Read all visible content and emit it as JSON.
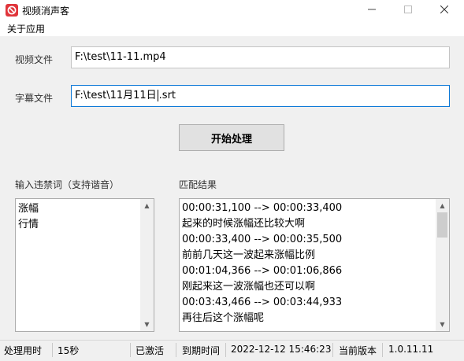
{
  "window": {
    "title": "视频消声客",
    "icon": "stop-sign-icon",
    "controls": {
      "minimize": "minimize-icon",
      "maximize": "maximize-icon",
      "close": "close-icon"
    }
  },
  "menu": {
    "items": [
      "关于应用"
    ]
  },
  "form": {
    "video_label": "视频文件",
    "video_value": "F:\\test\\11-11.mp4",
    "subtitle_label": "字幕文件",
    "subtitle_value_before_caret": "F:\\test\\11月11日",
    "subtitle_value_after_caret": ".srt"
  },
  "start_button": "开始处理",
  "banned_words": {
    "label": "输入违禁词（支持谐音）",
    "items": [
      "涨幅",
      "行情"
    ]
  },
  "results": {
    "label": "匹配结果",
    "lines": [
      "00:00:31,100 --> 00:00:33,400",
      "起来的时候涨幅还比较大啊",
      "00:00:33,400 --> 00:00:35,500",
      "前前几天这一波起来涨幅比例",
      "00:01:04,366 --> 00:01:06,866",
      "刚起来这一波涨幅也还可以啊",
      "00:03:43,466 --> 00:03:44,933",
      "再往后这个涨幅呢"
    ]
  },
  "status": {
    "elapsed_label": "处理用时",
    "elapsed_value": "15秒",
    "activation": "已激活",
    "expiry_label": "到期时间",
    "expiry_value": "2022-12-12 15:46:23",
    "version_label": "当前版本",
    "version_value": "1.0.11.11"
  },
  "colors": {
    "focus_border": "#0b78d7",
    "icon_red": "#e0353b"
  }
}
